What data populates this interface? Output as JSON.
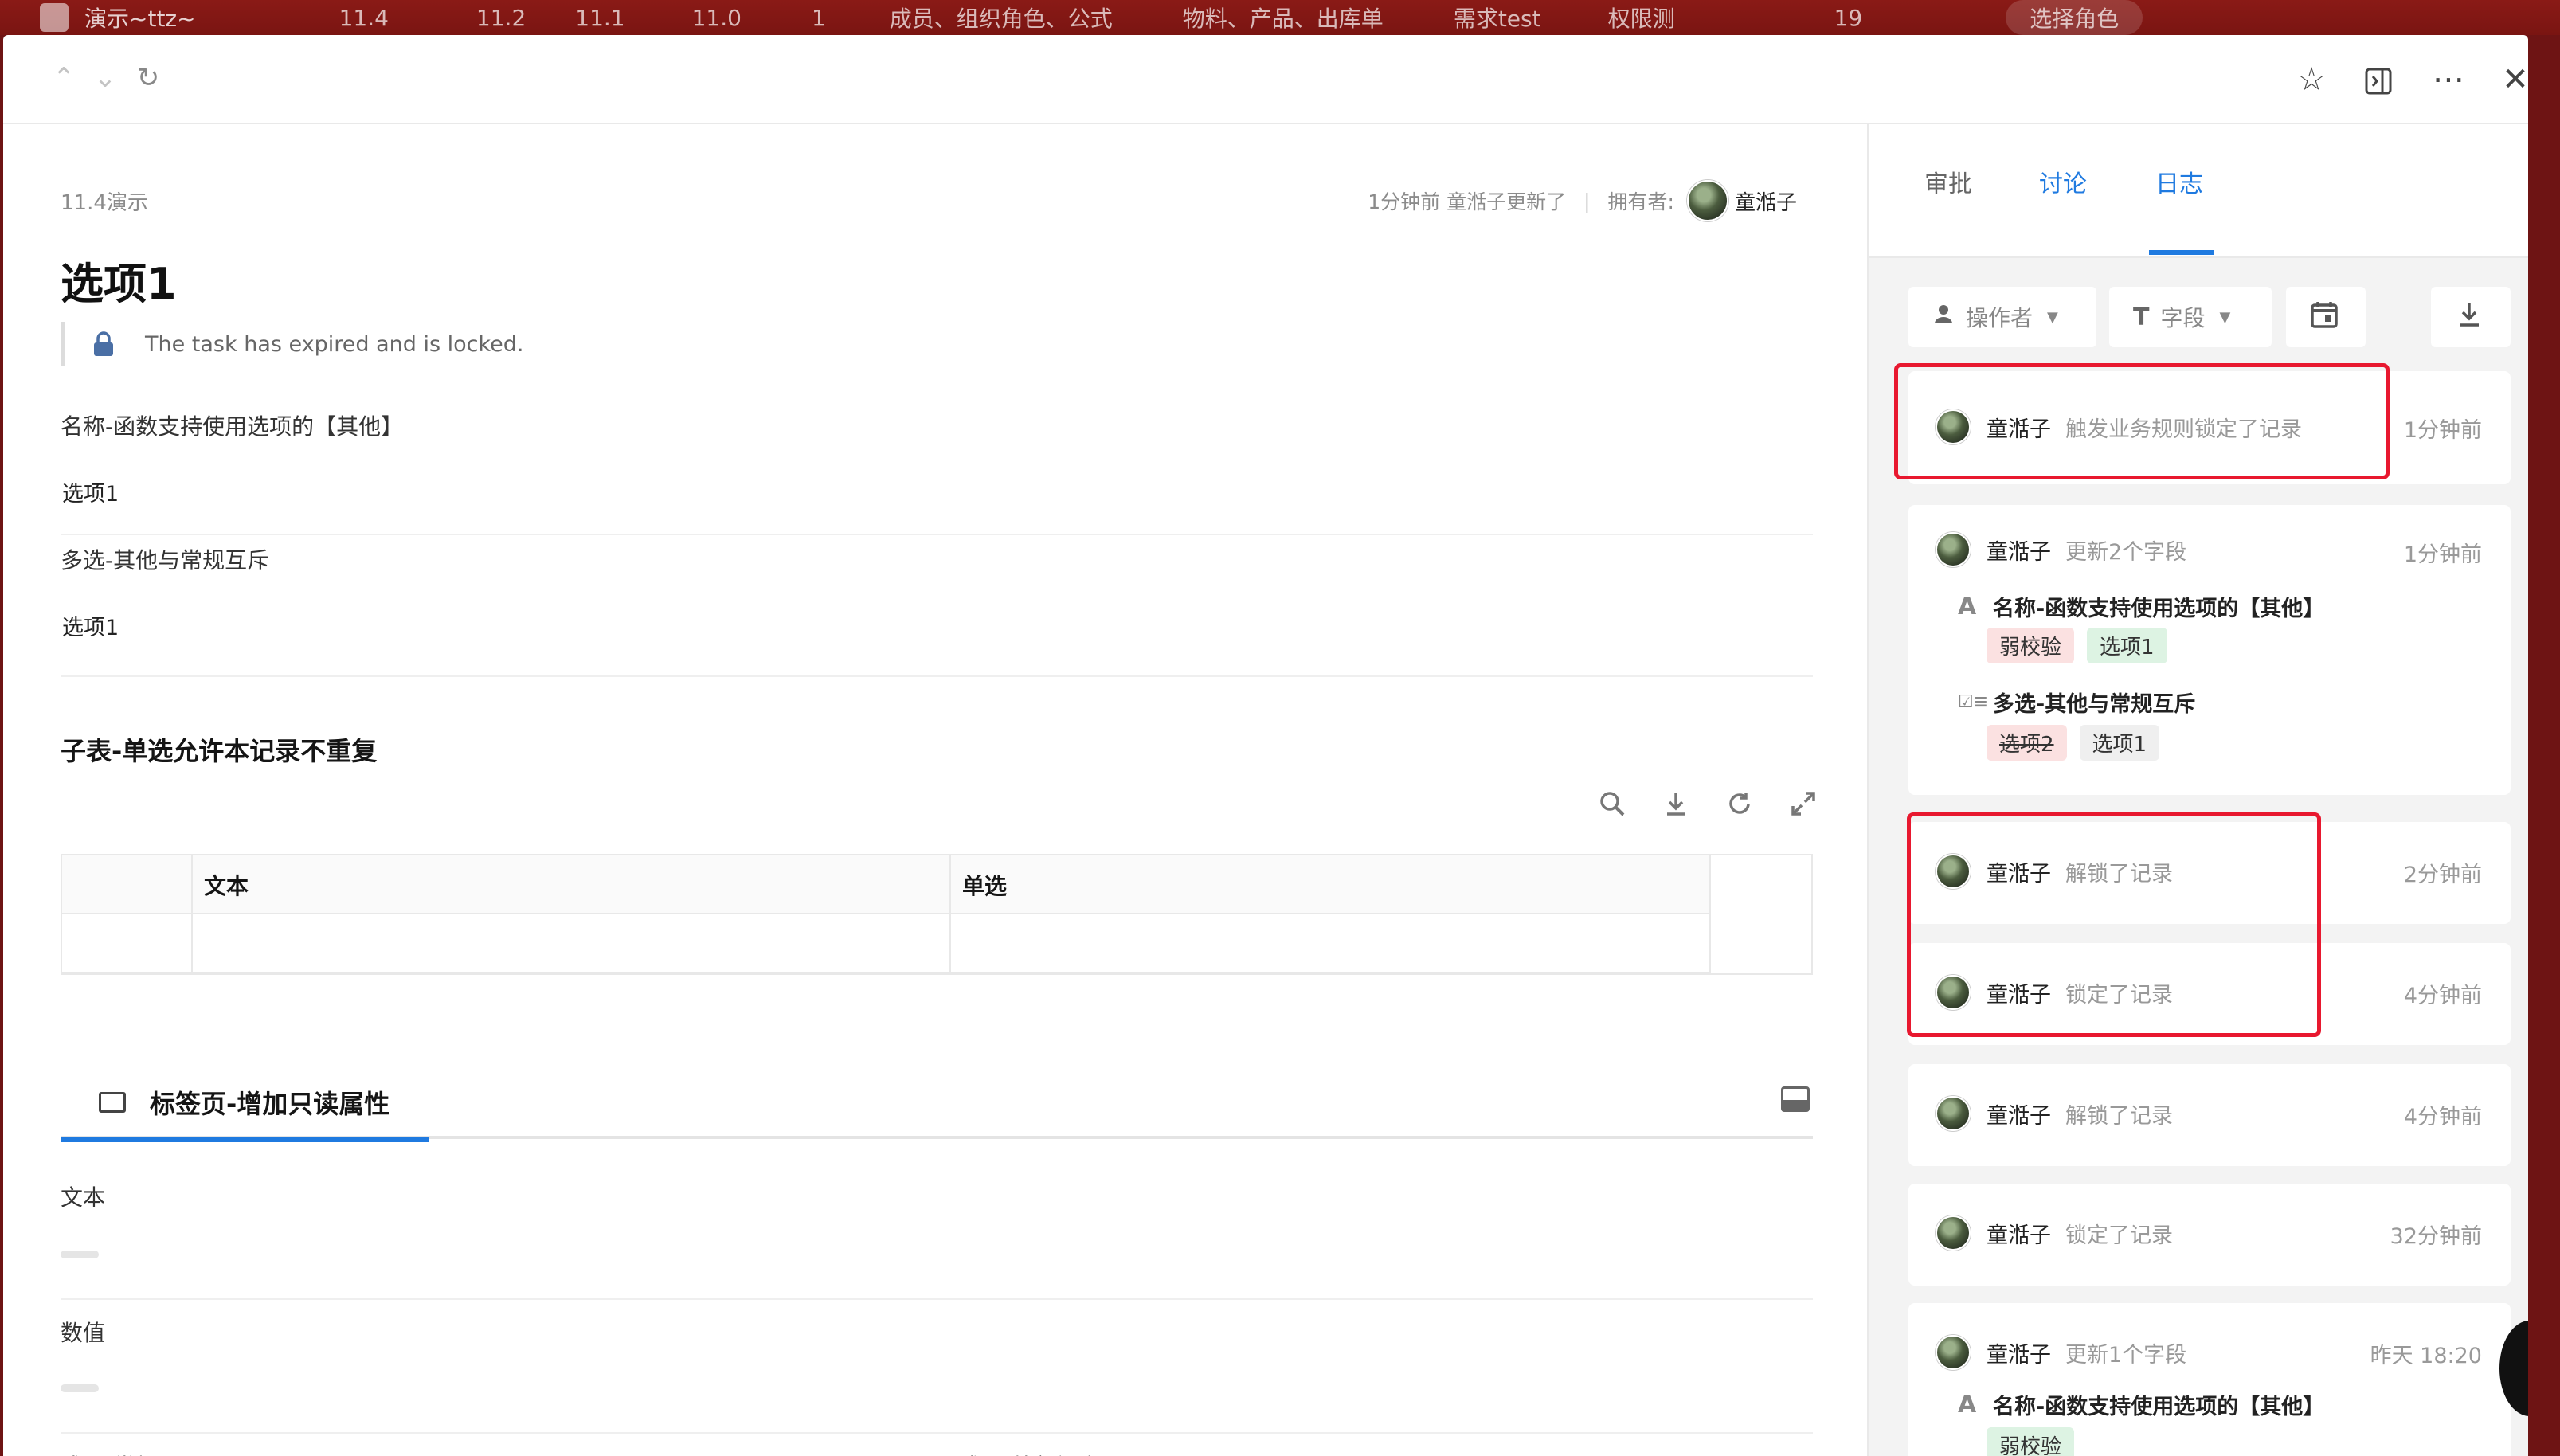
{
  "background": {
    "title": "演示~ttz~",
    "tabs": [
      "11.4",
      "11.2",
      "11.1",
      "11.0",
      "1",
      "成员、组织角色、公式",
      "物料、产品、出库单",
      "需求test",
      "权限测"
    ],
    "badge": "19",
    "role": "选择角色"
  },
  "modal": {
    "nav": {
      "prev_icon": "chevron-up-icon",
      "next_icon": "chevron-down-icon",
      "refresh_icon": "refresh-icon"
    },
    "actions": [
      "star-icon",
      "sidebar-toggle-icon",
      "more-icon",
      "close-icon"
    ]
  },
  "record": {
    "breadcrumb": "11.4演示",
    "updated_text": "1分钟前 童湉子更新了",
    "owner_label": "拥有者:",
    "owner_name": "童湉子",
    "title": "选项1",
    "locked_text": "The task has expired and is locked.",
    "fields": [
      {
        "label": "名称-函数支持使用选项的【其他】",
        "value": "选项1"
      },
      {
        "label": "多选-其他与常规互斥",
        "value": "选项1"
      }
    ],
    "subtable": {
      "title": "子表-单选允许本记录不重复",
      "columns": [
        "",
        "文本",
        "单选"
      ]
    },
    "tab_section": {
      "active_tab": "标签页-增加只读属性",
      "fields": [
        "文本",
        "数值"
      ],
      "bottom_fields": [
        "成员-常规",
        "成员-外部门户"
      ]
    }
  },
  "side": {
    "tabs": [
      "审批",
      "讨论",
      "日志"
    ],
    "active_tab": "日志",
    "filters": {
      "operator": "操作者",
      "field": "字段"
    },
    "logs": [
      {
        "user": "童湉子",
        "action": "触发业务规则锁定了记录",
        "time": "1分钟前"
      },
      {
        "user": "童湉子",
        "action": "更新2个字段",
        "time": "1分钟前",
        "changes": [
          {
            "field": "名称-函数支持使用选项的【其他】",
            "old": "弱校验",
            "new": "选项1"
          },
          {
            "field": "多选-其他与常规互斥",
            "old": "选项2",
            "new": "选项1"
          }
        ]
      },
      {
        "user": "童湉子",
        "action": "解锁了记录",
        "time": "2分钟前"
      },
      {
        "user": "童湉子",
        "action": "锁定了记录",
        "time": "4分钟前"
      },
      {
        "user": "童湉子",
        "action": "解锁了记录",
        "time": "4分钟前"
      },
      {
        "user": "童湉子",
        "action": "锁定了记录",
        "time": "32分钟前"
      },
      {
        "user": "童湉子",
        "action": "更新1个字段",
        "time": "昨天 18:20",
        "changes": [
          {
            "field": "名称-函数支持使用选项的【其他】",
            "old": "",
            "new": "弱校验"
          }
        ]
      }
    ]
  },
  "colors": {
    "accent": "#1f7ae0",
    "highlight": "#e8182f",
    "app_bar": "#7a1512"
  }
}
